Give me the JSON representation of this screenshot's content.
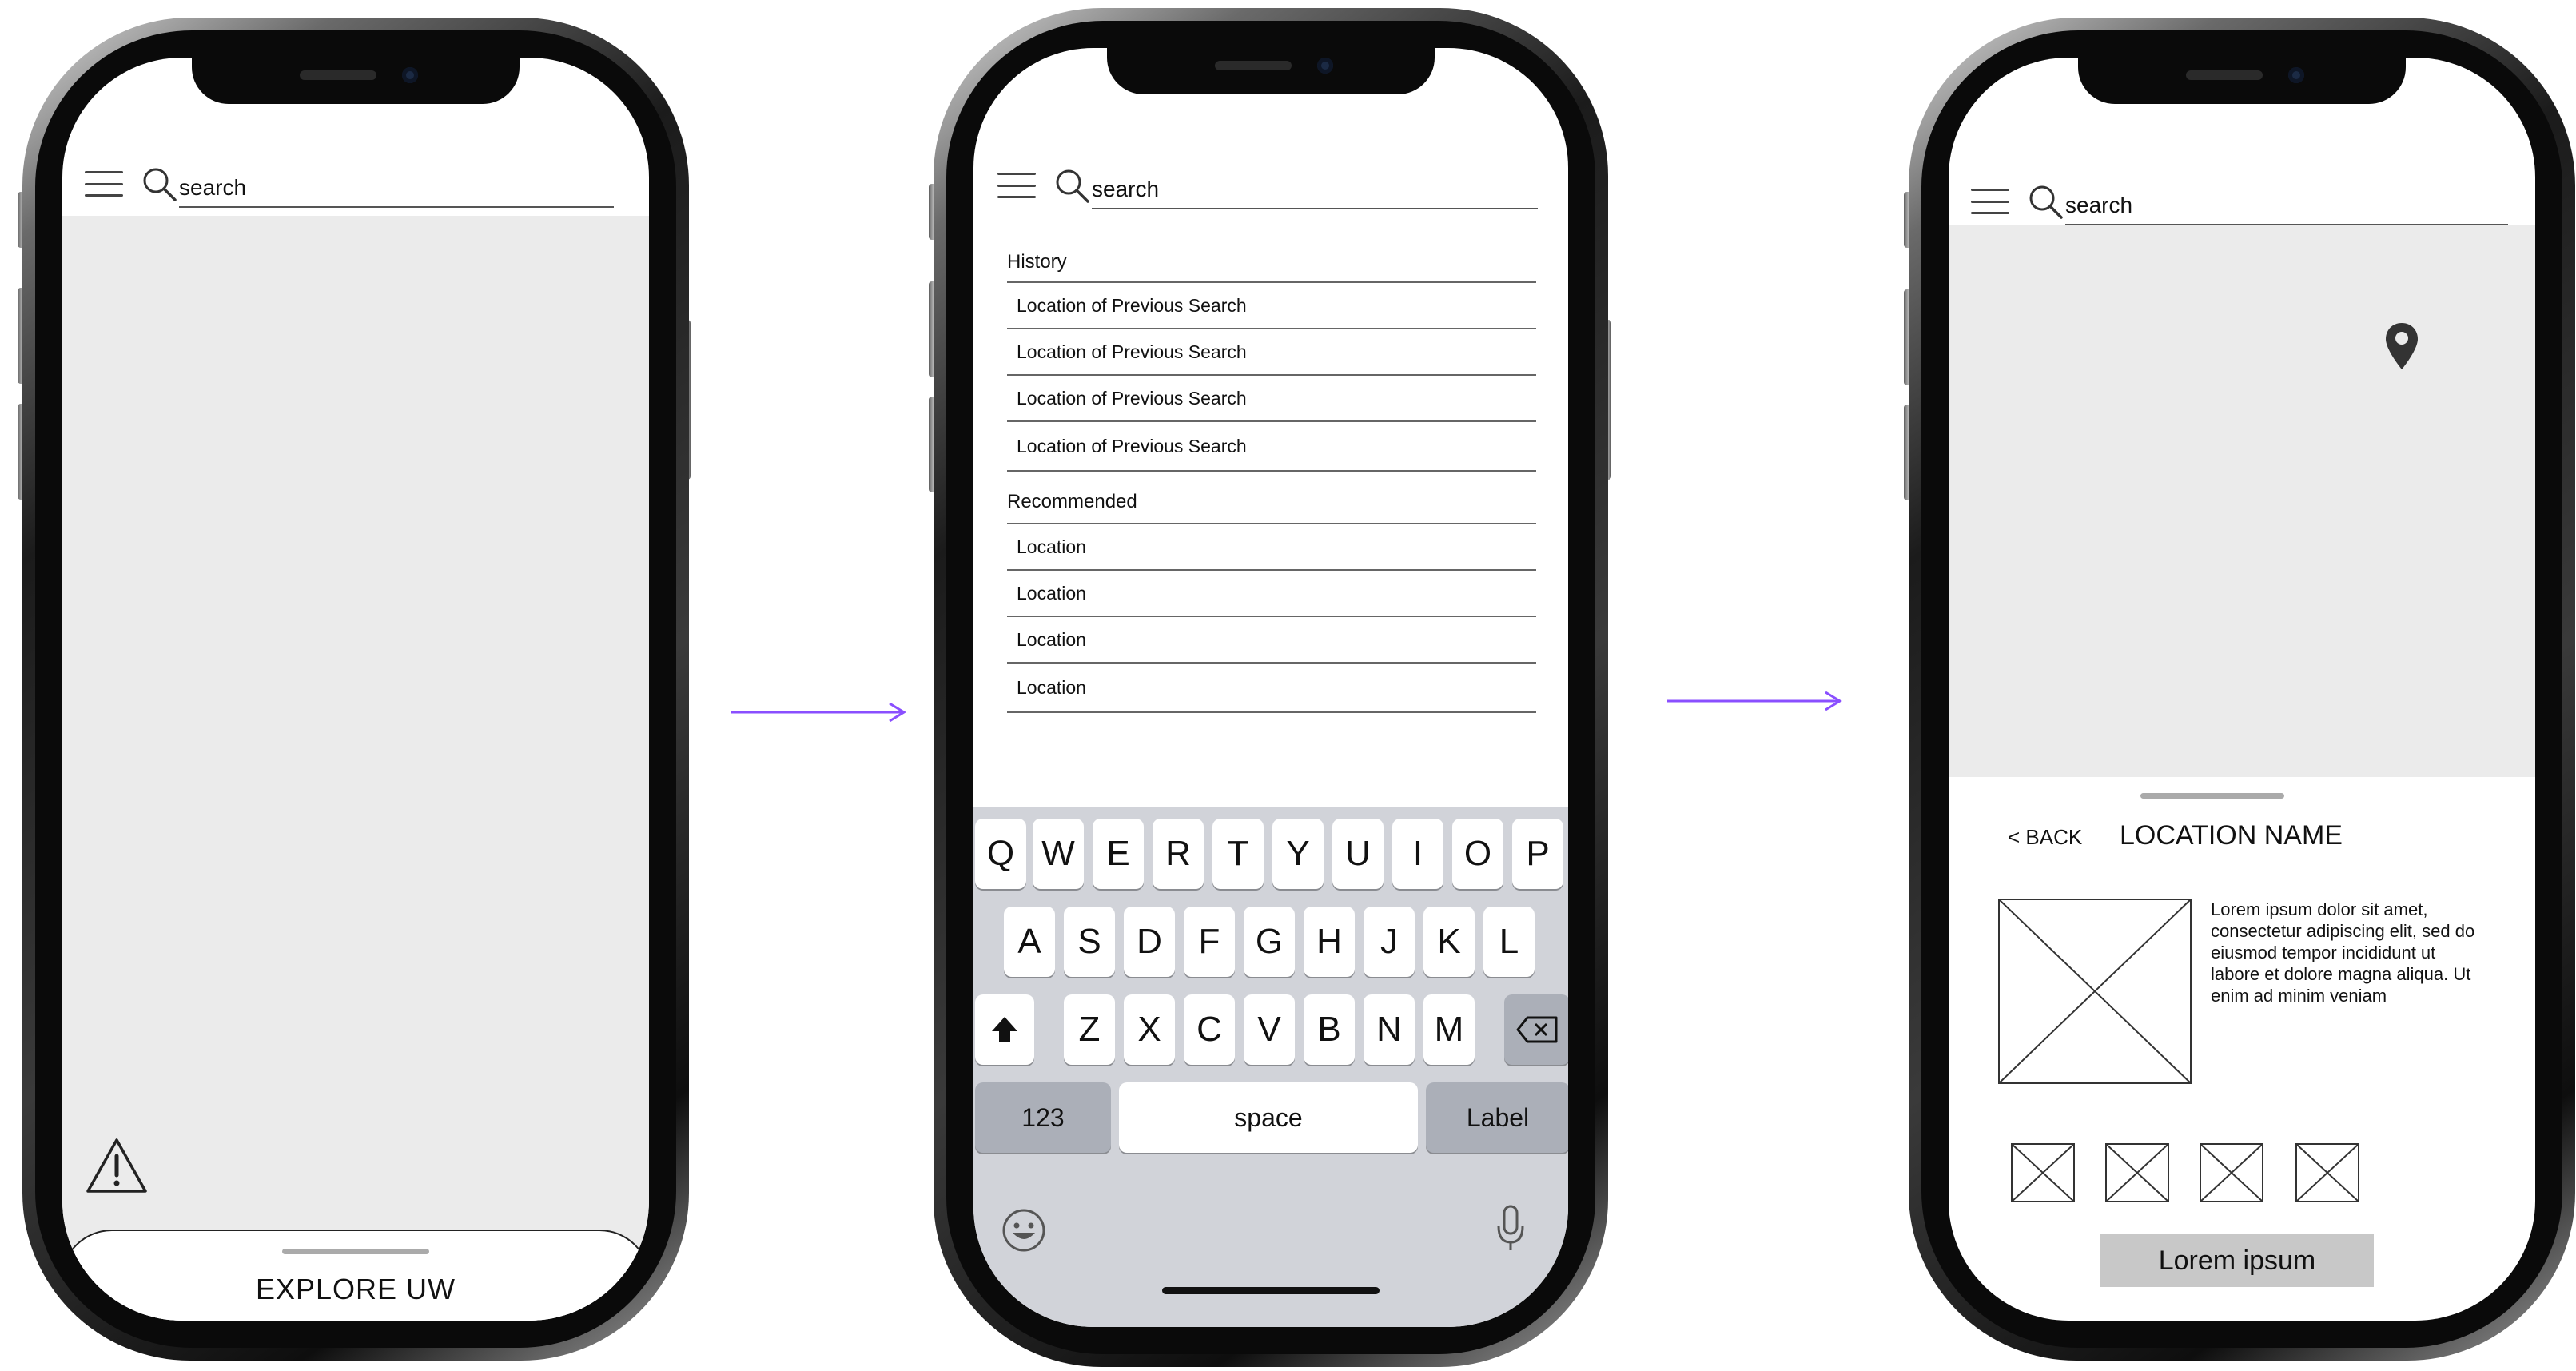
{
  "colors": {
    "arrow": "#8a4fff",
    "map_gray": "#ebebeb",
    "keyboard_bg": "#d1d3d9"
  },
  "screen1": {
    "search": {
      "placeholder": "search"
    },
    "icons": {
      "menu": "menu-icon",
      "search": "search-icon",
      "warning": "warning-icon"
    },
    "explore_label": "EXPLORE UW"
  },
  "screen2": {
    "search": {
      "placeholder": "search"
    },
    "history_title": "History",
    "history": [
      "Location of Previous Search",
      "Location of Previous Search",
      "Location of Previous Search",
      "Location of Previous Search"
    ],
    "recommended_title": "Recommended",
    "recommended": [
      "Location",
      "Location",
      "Location",
      "Location"
    ],
    "keyboard": {
      "row1": [
        "Q",
        "W",
        "E",
        "R",
        "T",
        "Y",
        "U",
        "I",
        "O",
        "P"
      ],
      "row2": [
        "A",
        "S",
        "D",
        "F",
        "G",
        "H",
        "J",
        "K",
        "L"
      ],
      "row3": [
        "Z",
        "X",
        "C",
        "V",
        "B",
        "N",
        "M"
      ],
      "numbers": "123",
      "space": "space",
      "label": "Label"
    }
  },
  "screen3": {
    "search": {
      "placeholder": "search"
    },
    "back_label": "< BACK",
    "location_name": "LOCATION NAME",
    "description": "Lorem ipsum dolor sit amet, consectetur adipiscing elit, sed do eiusmod tempor incididunt ut labore et dolore magna aliqua. Ut enim ad minim veniam",
    "button_label": "Lorem ipsum"
  }
}
